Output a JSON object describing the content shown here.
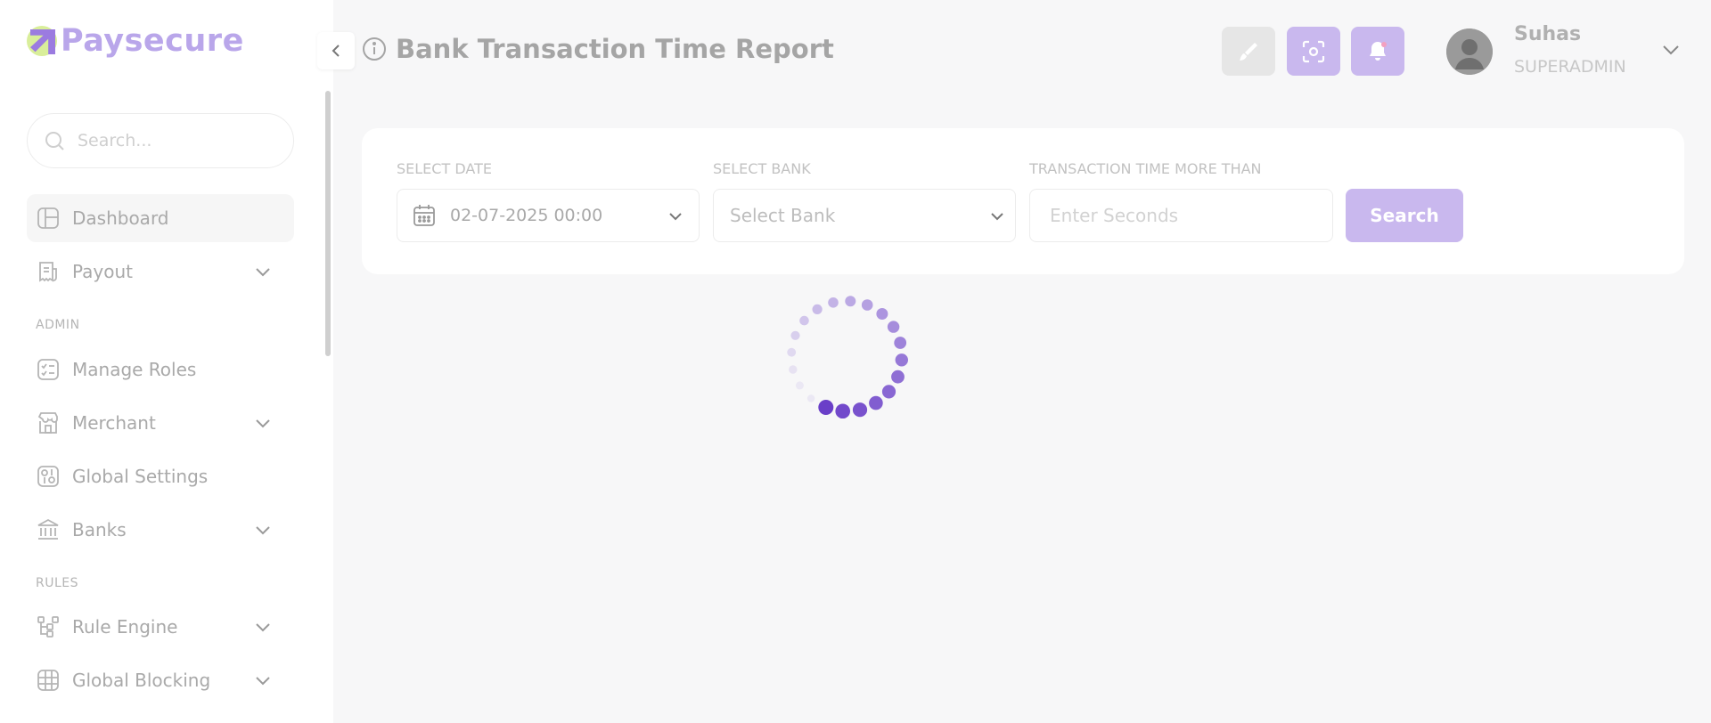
{
  "brand": {
    "name": "Paysecure"
  },
  "sidebar": {
    "search_placeholder": "Search...",
    "items": [
      {
        "label": "Dashboard",
        "icon": "dashboard-icon",
        "active": true
      },
      {
        "label": "Payout",
        "icon": "payout-icon",
        "has_children": true
      },
      {
        "label": "Manage Roles",
        "icon": "roles-icon"
      },
      {
        "label": "Merchant",
        "icon": "merchant-icon",
        "has_children": true
      },
      {
        "label": "Global Settings",
        "icon": "settings-icon"
      },
      {
        "label": "Banks",
        "icon": "bank-icon",
        "has_children": true
      },
      {
        "label": "Rule Engine",
        "icon": "rule-engine-icon",
        "has_children": true
      },
      {
        "label": "Global Blocking",
        "icon": "global-blocking-icon",
        "has_children": true
      }
    ],
    "sections": {
      "admin": "ADMIN",
      "rules": "RULES"
    }
  },
  "header": {
    "title": "Bank Transaction Time Report",
    "user": {
      "name": "Suhas",
      "role": "SUPERADMIN"
    }
  },
  "filters": {
    "date": {
      "label": "SELECT DATE",
      "value": "02-07-2025 00:00"
    },
    "bank": {
      "label": "SELECT BANK",
      "placeholder": "Select Bank"
    },
    "time": {
      "label": "TRANSACTION TIME MORE THAN",
      "placeholder": "Enter Seconds"
    },
    "search_label": "Search"
  },
  "colors": {
    "accent": "#c9b8ee",
    "brand": "#b9a6ea",
    "spinner": "#6a3fc8",
    "logo_mark": "#d9ee9a"
  }
}
